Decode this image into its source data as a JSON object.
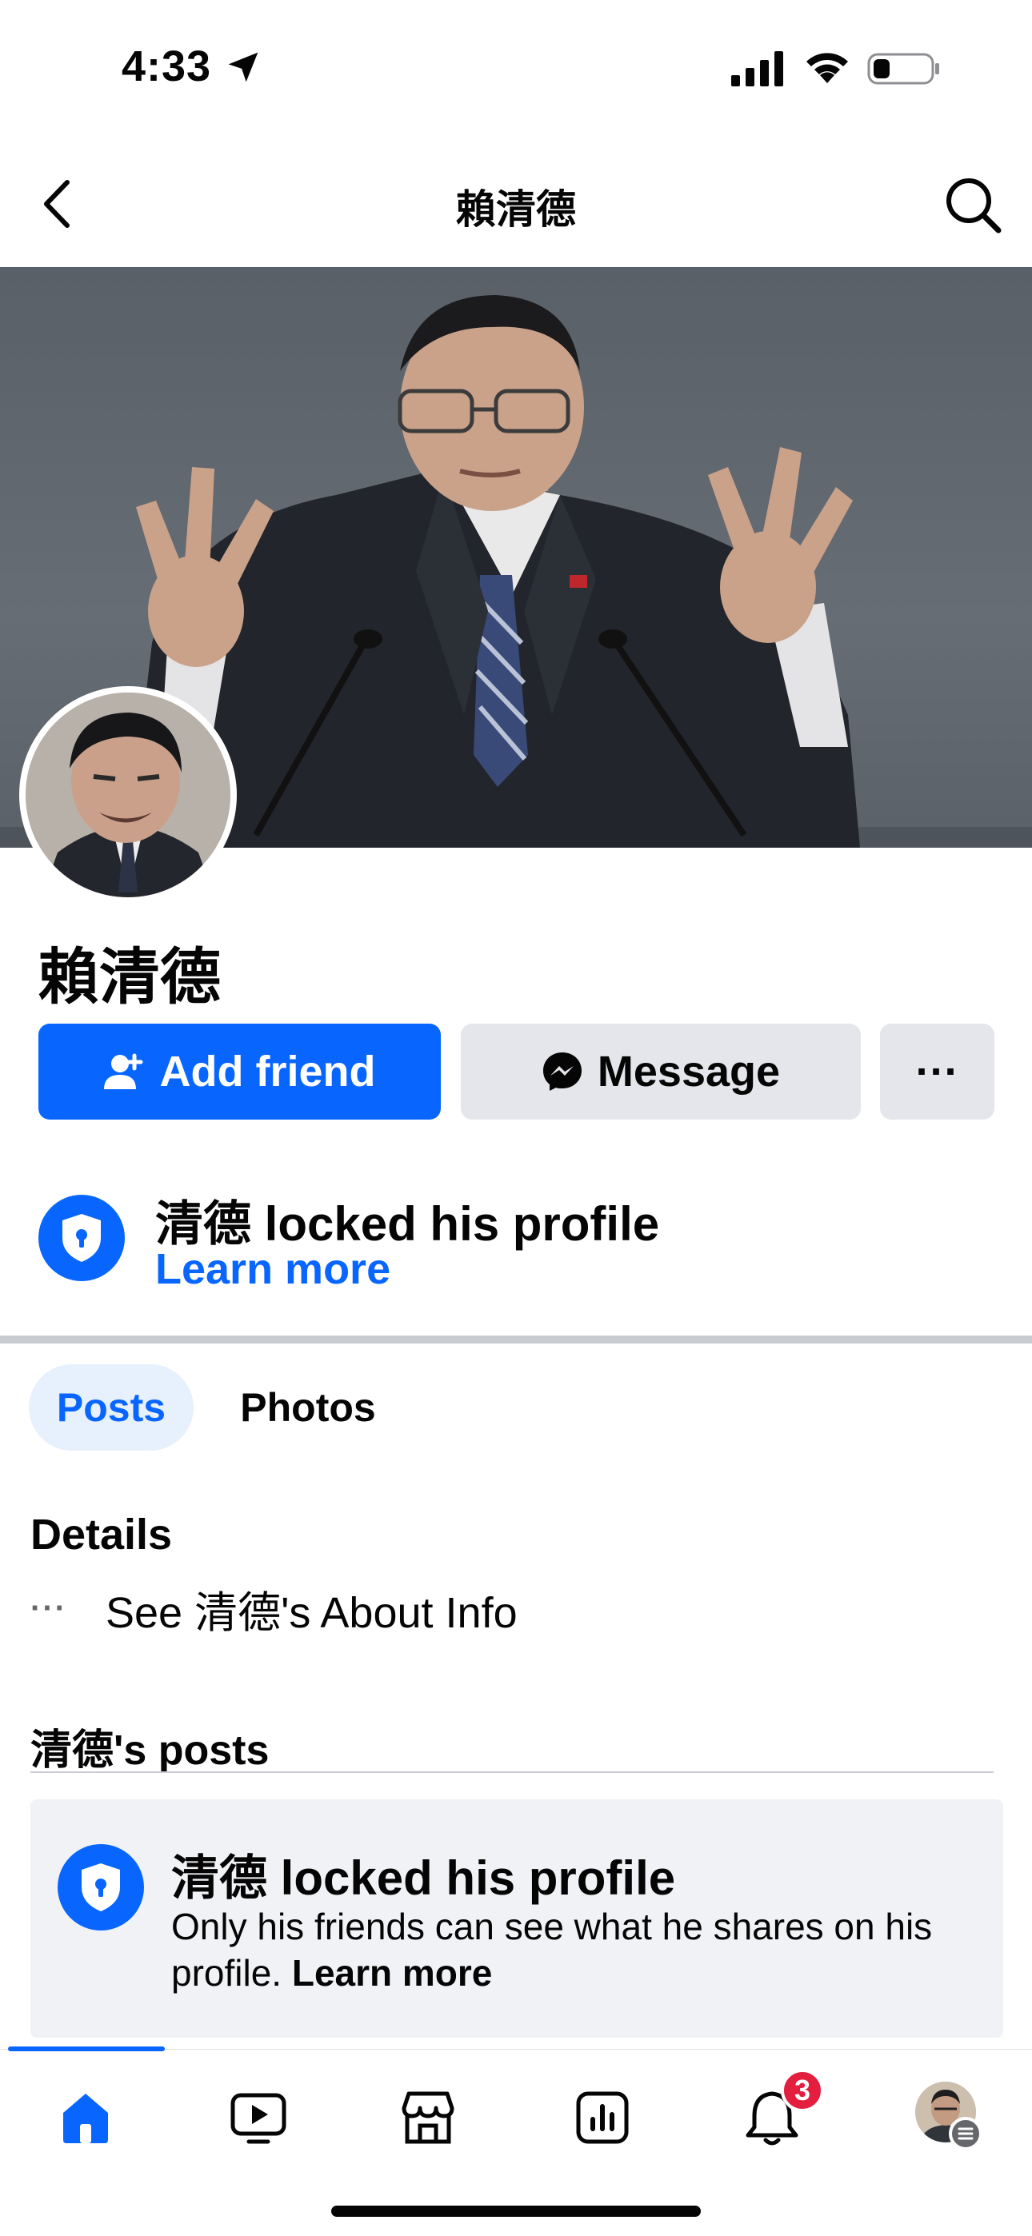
{
  "status_bar": {
    "time": "4:33"
  },
  "header": {
    "title": "賴清德"
  },
  "profile": {
    "name": "賴清德",
    "add_friend_label": "Add friend",
    "message_label": "Message",
    "more_label": "···"
  },
  "lock_notice": {
    "title": "清德 locked his profile",
    "link": "Learn more"
  },
  "tabs": [
    {
      "label": "Posts",
      "active": true
    },
    {
      "label": "Photos",
      "active": false
    }
  ],
  "details": {
    "title": "Details",
    "about_dots": "···",
    "about_text": "See 清德's About Info"
  },
  "posts_section": {
    "title": "清德's posts",
    "card_title": "清德 locked his profile",
    "card_body": "Only his friends can see what he shares on his profile.",
    "card_link": "Learn more"
  },
  "bottom_nav": {
    "items": [
      "home-icon",
      "video-icon",
      "marketplace-icon",
      "dashboard-icon",
      "notifications-icon",
      "profile-avatar"
    ],
    "notification_count": "3"
  },
  "colors": {
    "accent": "#0866ff",
    "badge": "#e41e3f",
    "button_gray": "#e4e6eb"
  }
}
